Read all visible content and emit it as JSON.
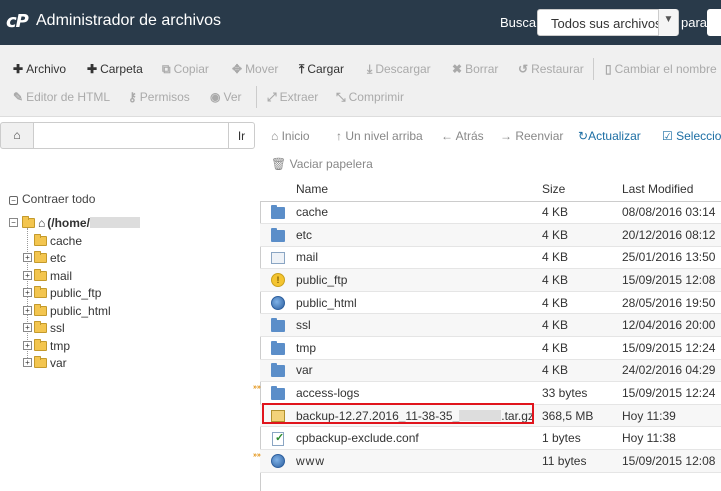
{
  "header": {
    "title": "Administrador de archivos",
    "search_label": "Buscar",
    "search_scope": "Todos sus archivos",
    "for_label": "para"
  },
  "toolbar": {
    "row1": [
      {
        "name": "file",
        "label": "Archivo",
        "icon": "plus-icon",
        "enabled": true
      },
      {
        "name": "folder",
        "label": "Carpeta",
        "icon": "plus-icon",
        "enabled": true
      },
      {
        "name": "copy",
        "label": "Copiar",
        "icon": "copy-icon",
        "enabled": false
      },
      {
        "name": "move",
        "label": "Mover",
        "icon": "move-icon",
        "enabled": false
      },
      {
        "name": "upload",
        "label": "Cargar",
        "icon": "upload-icon",
        "enabled": true
      },
      {
        "name": "download",
        "label": "Descargar",
        "icon": "download-icon",
        "enabled": false
      },
      {
        "name": "delete",
        "label": "Borrar",
        "icon": "x-icon",
        "enabled": false
      },
      {
        "name": "restore",
        "label": "Restaurar",
        "icon": "undo-icon",
        "enabled": false
      },
      {
        "name": "rename",
        "label": "Cambiar el nombre",
        "icon": "document-icon",
        "enabled": false
      }
    ],
    "row2": [
      {
        "name": "html-editor",
        "label": "Editor de HTML",
        "icon": "pencil-icon",
        "enabled": false
      },
      {
        "name": "permissions",
        "label": "Permisos",
        "icon": "key-icon",
        "enabled": false
      },
      {
        "name": "view",
        "label": "Ver",
        "icon": "eye-icon",
        "enabled": false
      },
      {
        "name": "extract",
        "label": "Extraer",
        "icon": "expand-icon",
        "enabled": false
      },
      {
        "name": "compress",
        "label": "Comprimir",
        "icon": "compress-icon",
        "enabled": false
      }
    ]
  },
  "pathbar": {
    "value": "",
    "go_label": "Ir"
  },
  "nav": {
    "home": "Inicio",
    "up": "Un nivel arriba",
    "back": "Atrás",
    "forward": "Reenviar",
    "refresh": "Actualizar",
    "select_all": "Seleccionar",
    "empty_trash": "Vaciar papelera"
  },
  "tree": {
    "collapse_all": "Contraer todo",
    "root": "(/home/",
    "items": [
      "cache",
      "etc",
      "mail",
      "public_ftp",
      "public_html",
      "ssl",
      "tmp",
      "var"
    ]
  },
  "table": {
    "headers": {
      "name": "Name",
      "size": "Size",
      "modified": "Last Modified"
    },
    "rows": [
      {
        "icon": "folder-icon",
        "name": "cache",
        "size": "4 KB",
        "modified": "08/08/2016 03:14",
        "link": false
      },
      {
        "icon": "folder-icon",
        "name": "etc",
        "size": "4 KB",
        "modified": "20/12/2016 08:12",
        "link": false
      },
      {
        "icon": "mail-icon",
        "name": "mail",
        "size": "4 KB",
        "modified": "25/01/2016 13:50",
        "link": false
      },
      {
        "icon": "ftp-icon",
        "name": "public_ftp",
        "size": "4 KB",
        "modified": "15/09/2015 12:08",
        "link": false
      },
      {
        "icon": "globe-icon",
        "name": "public_html",
        "size": "4 KB",
        "modified": "28/05/2016 19:50",
        "link": false
      },
      {
        "icon": "folder-icon",
        "name": "ssl",
        "size": "4 KB",
        "modified": "12/04/2016 20:00",
        "link": false
      },
      {
        "icon": "folder-icon",
        "name": "tmp",
        "size": "4 KB",
        "modified": "15/09/2015 12:24",
        "link": false
      },
      {
        "icon": "folder-icon",
        "name": "var",
        "size": "4 KB",
        "modified": "24/02/2016 04:29",
        "link": false
      },
      {
        "icon": "folder-icon",
        "name": "access-logs",
        "size": "33 bytes",
        "modified": "15/09/2015 12:24",
        "link": true
      },
      {
        "icon": "archive-icon",
        "name": "backup-12.27.2016_11-38-35_",
        "name_suffix": ".tar.gz",
        "size": "368,5 MB",
        "modified": "Hoy 11:39",
        "link": false,
        "redacted": true
      },
      {
        "icon": "config-file-icon",
        "name": "cpbackup-exclude.conf",
        "size": "1 bytes",
        "modified": "Hoy 11:38",
        "link": false
      },
      {
        "icon": "globe-icon",
        "name": "www",
        "size": "11 bytes",
        "modified": "15/09/2015 12:08",
        "link": true
      }
    ]
  },
  "colors": {
    "header_bg": "#293a4a",
    "highlight_border": "#e0141c",
    "link_blue": "#1c6ea4"
  }
}
